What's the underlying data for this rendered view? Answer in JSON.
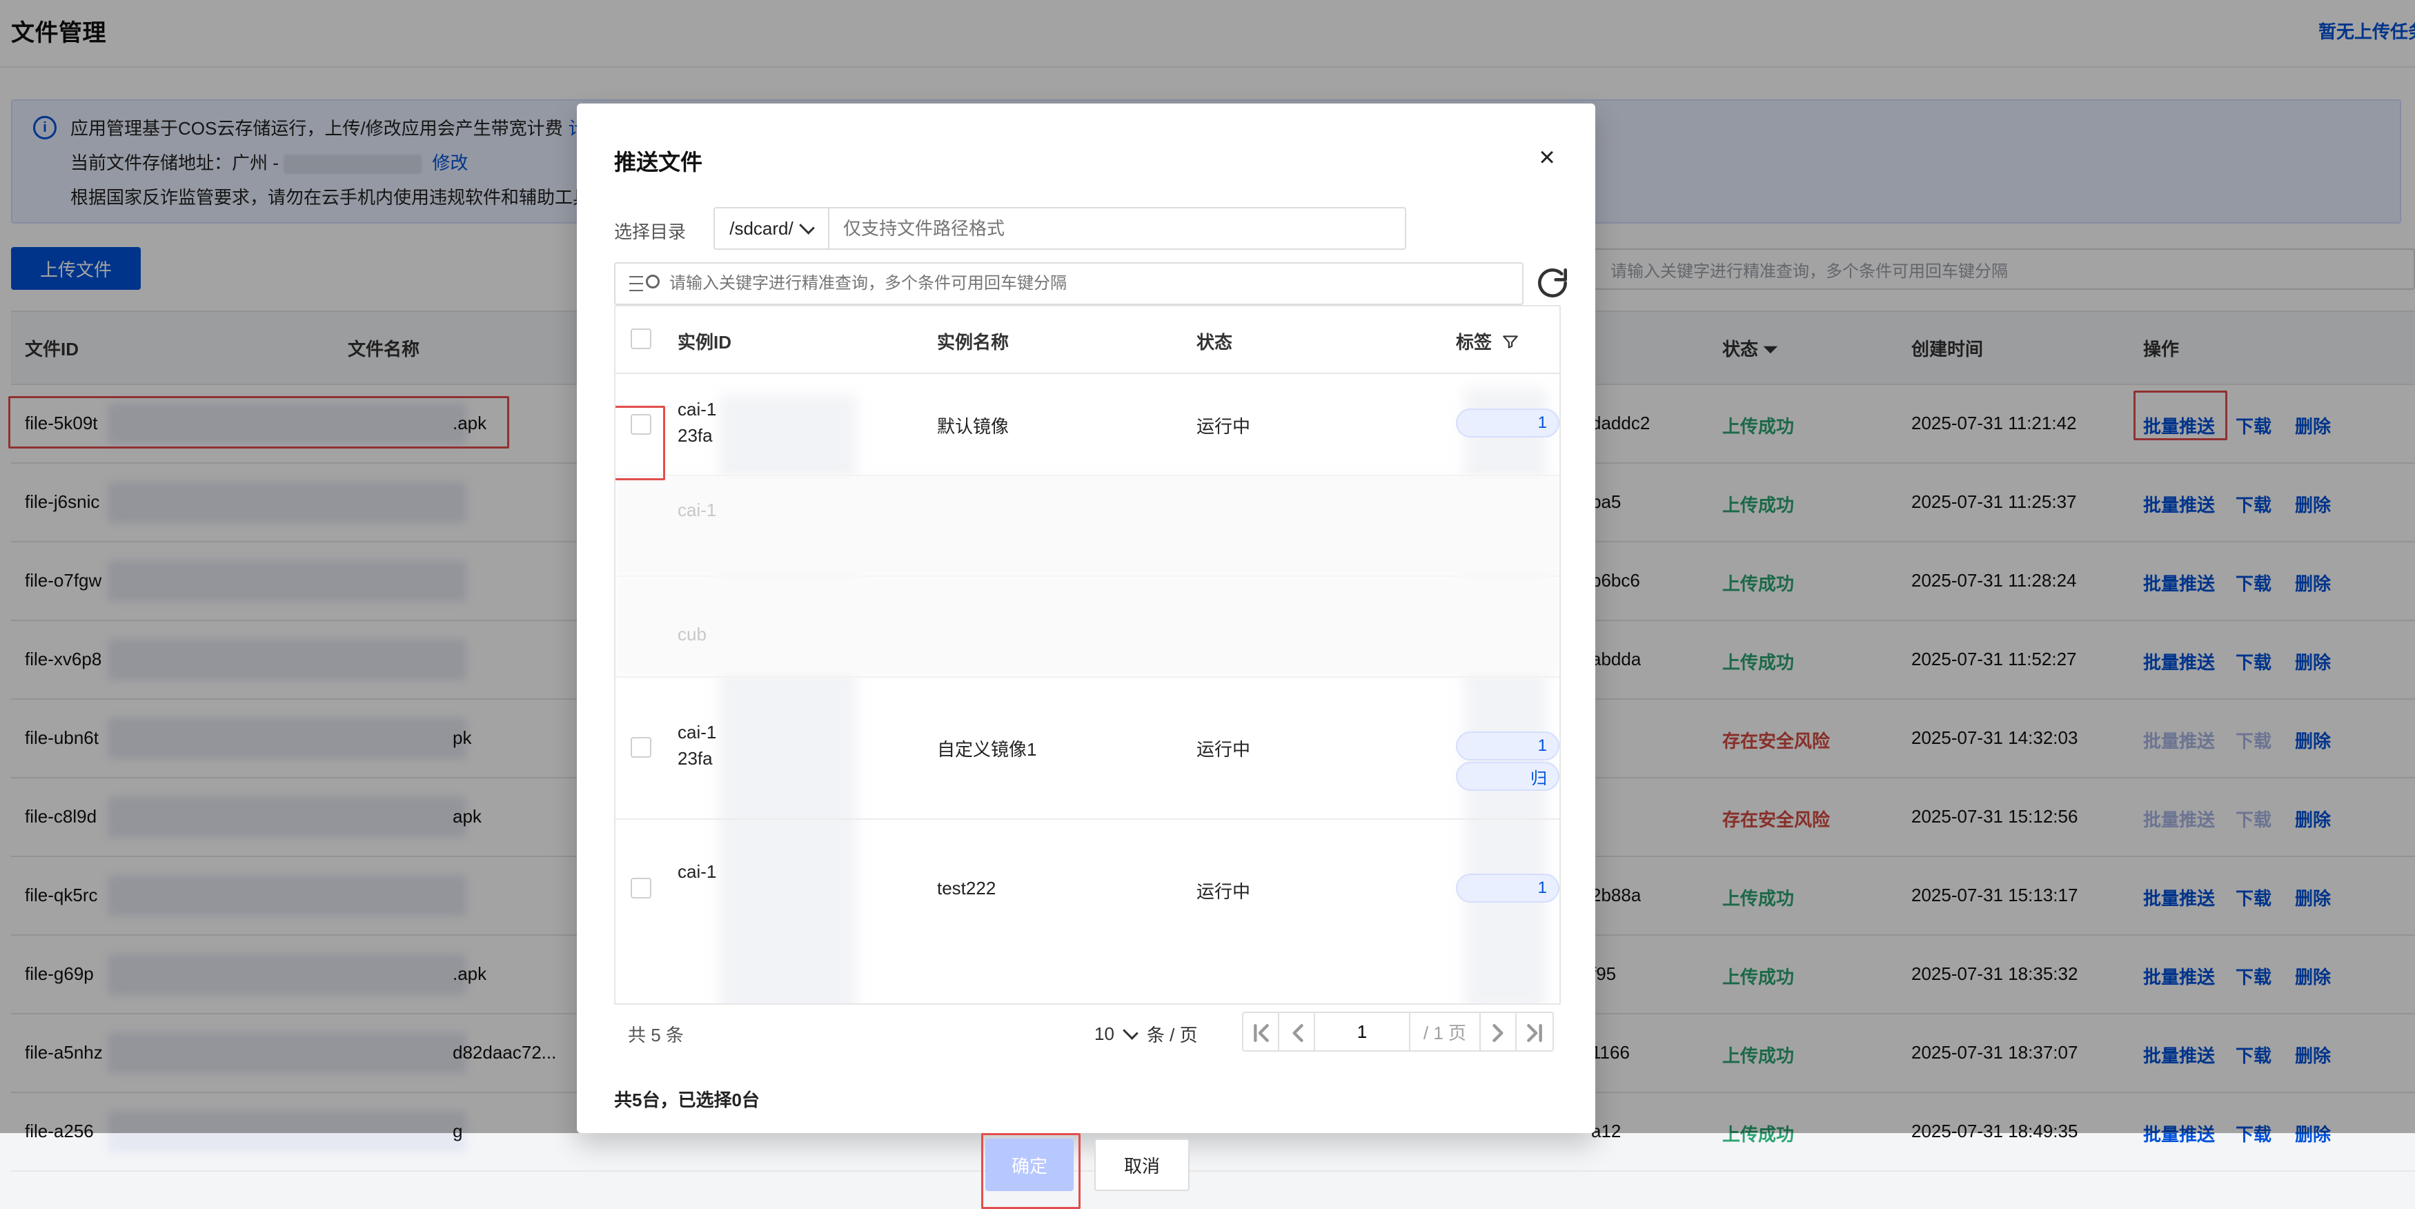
{
  "page": {
    "title": "文件管理",
    "top_right_link": "暂无上传任务",
    "info": {
      "line1_text": "应用管理基于COS云存储运行，上传/修改应用会产生带宽计费",
      "line1_link": "计",
      "line2_prefix": "当前文件存储地址：广州 -",
      "line2_link": "修改",
      "line3_text": "根据国家反诈监管要求，请勿在云手机内使用违规软件和辅助工具"
    },
    "upload_button": "上传文件",
    "search_placeholder": "请输入关键字进行精准查询，多个条件可用回车键分隔",
    "table": {
      "headers": {
        "file_id": "文件ID",
        "file_name": "文件名称",
        "status": "状态",
        "created": "创建时间",
        "ops": "操作"
      },
      "rows": [
        {
          "id": "file-5k09t",
          "name": ".apk",
          "hash": "daddc2",
          "status": "上传成功",
          "created": "2025-07-31 11:21:42"
        },
        {
          "id": "file-j6snic",
          "name": "",
          "hash": "ba5",
          "status": "上传成功",
          "created": "2025-07-31 11:25:37"
        },
        {
          "id": "file-o7fgw",
          "name": "",
          "hash": "b6bc6",
          "status": "上传成功",
          "created": "2025-07-31 11:28:24"
        },
        {
          "id": "file-xv6p8",
          "name": "",
          "hash": "abdda",
          "status": "上传成功",
          "created": "2025-07-31 11:52:27"
        },
        {
          "id": "file-ubn6t",
          "name": "pk",
          "hash": "",
          "status": "存在安全风险",
          "created": "2025-07-31 14:32:03"
        },
        {
          "id": "file-c8l9d",
          "name": "apk",
          "hash": "",
          "status": "存在安全风险",
          "created": "2025-07-31 15:12:56"
        },
        {
          "id": "file-qk5rc",
          "name": "",
          "hash": "2b88a",
          "status": "上传成功",
          "created": "2025-07-31 15:13:17"
        },
        {
          "id": "file-g69p",
          "name": ".apk",
          "hash": "f95",
          "status": "上传成功",
          "created": "2025-07-31 18:35:32"
        },
        {
          "id": "file-a5nhz",
          "name": "d82daac72...",
          "hash": "1166",
          "status": "上传成功",
          "created": "2025-07-31 18:37:07"
        },
        {
          "id": "file-a256",
          "name": "g",
          "hash": "a12",
          "status": "上传成功",
          "created": "2025-07-31 18:49:35"
        }
      ],
      "ops": {
        "push": "批量推送",
        "download": "下载",
        "delete": "删除"
      }
    }
  },
  "modal": {
    "title": "推送文件",
    "dir_label": "选择目录",
    "dir_select": "/sdcard/",
    "dir_placeholder": "仅支持文件路径格式",
    "search_placeholder": "请输入关键字进行精准查询，多个条件可用回车键分隔",
    "table_headers": {
      "id": "实例ID",
      "name": "实例名称",
      "status": "状态",
      "tag": "标签"
    },
    "rows": [
      {
        "id_line1": "cai-1",
        "id_line2": "23fa",
        "name": "默认镜像",
        "status": "运行中",
        "tags": [
          "1"
        ]
      },
      {
        "id_line1": "cai-1",
        "id_line2": "",
        "name": "",
        "status": "",
        "tags": []
      },
      {
        "id_line1": "cub",
        "id_line2": "",
        "name": "",
        "status": "",
        "tags": []
      },
      {
        "id_line1": "cai-1",
        "id_line2": "23fa",
        "name": "自定义镜像1",
        "status": "运行中",
        "tags": [
          "1",
          "归"
        ]
      },
      {
        "id_line1": "cai-1",
        "id_line2": "",
        "name": "test222",
        "status": "运行中",
        "tags": [
          "1"
        ]
      }
    ],
    "footer": {
      "total": "共 5 条",
      "page_size": "10",
      "page_size_unit": "条 / 页",
      "page_input": "1",
      "page_total": "/ 1 页"
    },
    "summary": "共5台，已选择0台",
    "ok": "确定",
    "cancel": "取消"
  }
}
